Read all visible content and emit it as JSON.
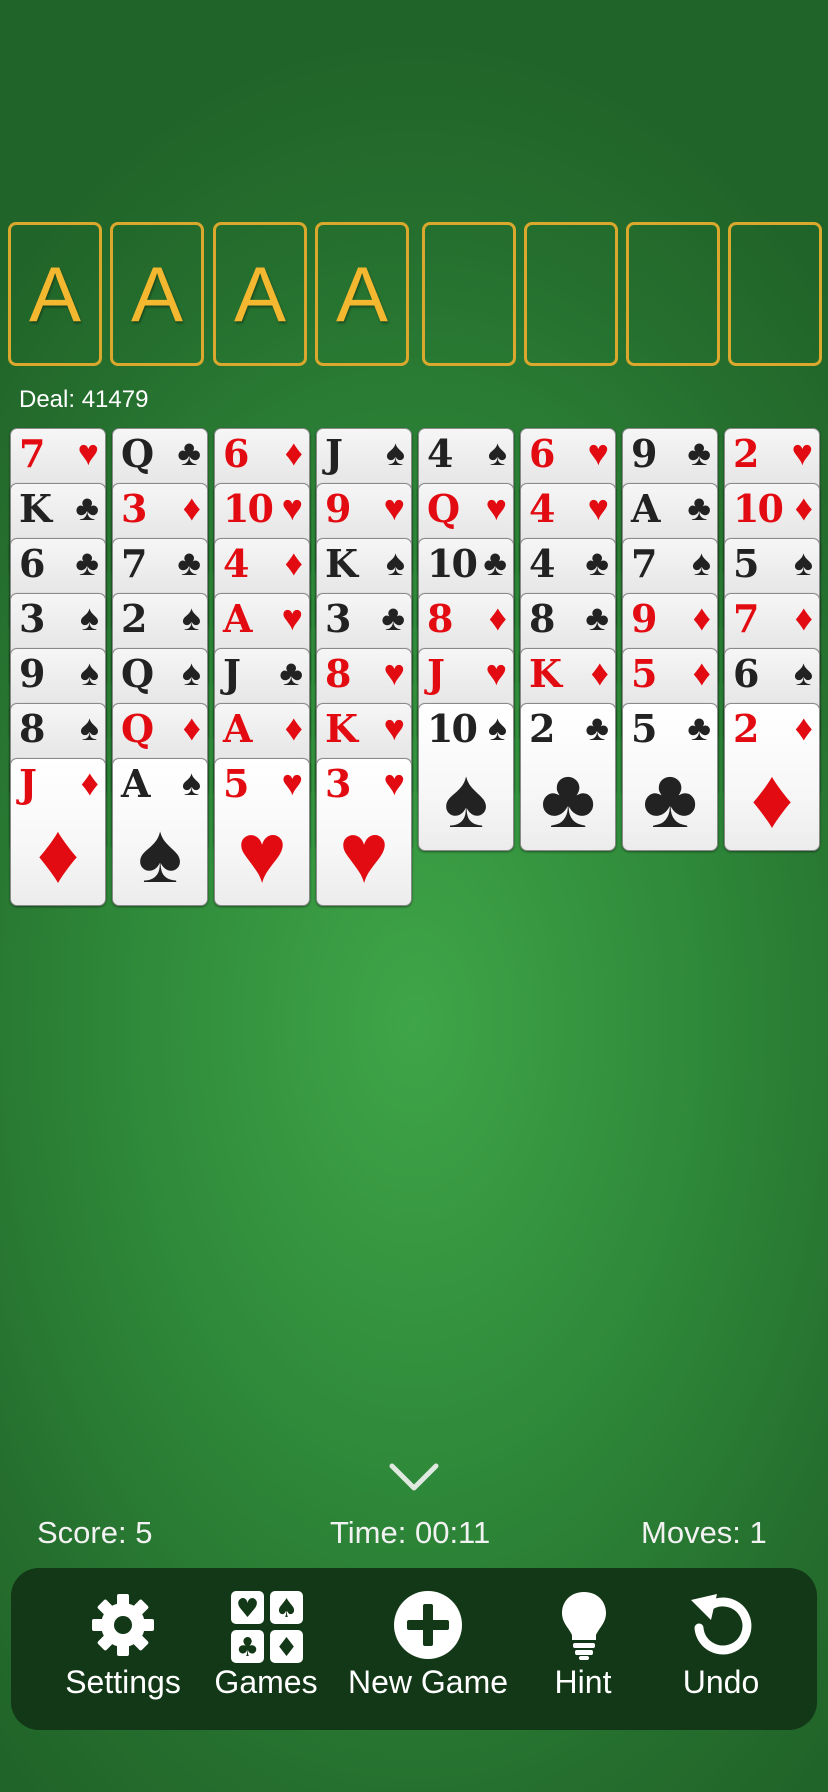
{
  "foundations": [
    {
      "label": "A"
    },
    {
      "label": "A"
    },
    {
      "label": "A"
    },
    {
      "label": "A"
    },
    {
      "label": ""
    },
    {
      "label": ""
    },
    {
      "label": ""
    },
    {
      "label": ""
    }
  ],
  "deal_text": "Deal: 41479",
  "suit_glyphs": {
    "S": "♠",
    "H": "♥",
    "D": "♦",
    "C": "♣"
  },
  "columns": [
    [
      {
        "rank": "7",
        "suit": "H"
      },
      {
        "rank": "K",
        "suit": "C"
      },
      {
        "rank": "6",
        "suit": "C"
      },
      {
        "rank": "3",
        "suit": "S"
      },
      {
        "rank": "9",
        "suit": "S"
      },
      {
        "rank": "8",
        "suit": "S"
      },
      {
        "rank": "J",
        "suit": "D"
      }
    ],
    [
      {
        "rank": "Q",
        "suit": "C"
      },
      {
        "rank": "3",
        "suit": "D"
      },
      {
        "rank": "7",
        "suit": "C"
      },
      {
        "rank": "2",
        "suit": "S"
      },
      {
        "rank": "Q",
        "suit": "S"
      },
      {
        "rank": "Q",
        "suit": "D"
      },
      {
        "rank": "A",
        "suit": "S"
      }
    ],
    [
      {
        "rank": "6",
        "suit": "D"
      },
      {
        "rank": "10",
        "suit": "H"
      },
      {
        "rank": "4",
        "suit": "D"
      },
      {
        "rank": "A",
        "suit": "H"
      },
      {
        "rank": "J",
        "suit": "C"
      },
      {
        "rank": "A",
        "suit": "D"
      },
      {
        "rank": "5",
        "suit": "H"
      }
    ],
    [
      {
        "rank": "J",
        "suit": "S"
      },
      {
        "rank": "9",
        "suit": "H"
      },
      {
        "rank": "K",
        "suit": "S"
      },
      {
        "rank": "3",
        "suit": "C"
      },
      {
        "rank": "8",
        "suit": "H"
      },
      {
        "rank": "K",
        "suit": "H"
      },
      {
        "rank": "3",
        "suit": "H"
      }
    ],
    [
      {
        "rank": "4",
        "suit": "S"
      },
      {
        "rank": "Q",
        "suit": "H"
      },
      {
        "rank": "10",
        "suit": "C"
      },
      {
        "rank": "8",
        "suit": "D"
      },
      {
        "rank": "J",
        "suit": "H"
      },
      {
        "rank": "10",
        "suit": "S"
      }
    ],
    [
      {
        "rank": "6",
        "suit": "H"
      },
      {
        "rank": "4",
        "suit": "H"
      },
      {
        "rank": "4",
        "suit": "C"
      },
      {
        "rank": "8",
        "suit": "C"
      },
      {
        "rank": "K",
        "suit": "D"
      },
      {
        "rank": "2",
        "suit": "C"
      }
    ],
    [
      {
        "rank": "9",
        "suit": "C"
      },
      {
        "rank": "A",
        "suit": "C"
      },
      {
        "rank": "7",
        "suit": "S"
      },
      {
        "rank": "9",
        "suit": "D"
      },
      {
        "rank": "5",
        "suit": "D"
      },
      {
        "rank": "5",
        "suit": "C"
      }
    ],
    [
      {
        "rank": "2",
        "suit": "H"
      },
      {
        "rank": "10",
        "suit": "D"
      },
      {
        "rank": "5",
        "suit": "S"
      },
      {
        "rank": "7",
        "suit": "D"
      },
      {
        "rank": "6",
        "suit": "S"
      },
      {
        "rank": "2",
        "suit": "D"
      }
    ]
  ],
  "stats": {
    "score": "Score: 5",
    "time": "Time: 00:11",
    "moves": "Moves: 1"
  },
  "toolbar": {
    "settings": "Settings",
    "games": "Games",
    "new_game": "New Game",
    "hint": "Hint",
    "undo": "Undo"
  },
  "colors": {
    "red": "#e30b12",
    "black": "#222222",
    "foundation_border": "#d9a82c",
    "toolbar_bg": "#133817"
  }
}
